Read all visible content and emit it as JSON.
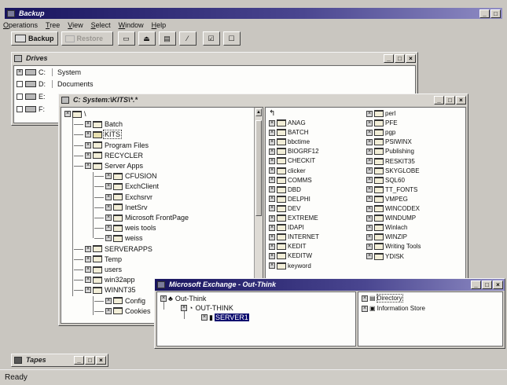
{
  "app": {
    "title": "Backup",
    "menus": [
      "Operations",
      "Tree",
      "View",
      "Select",
      "Window",
      "Help"
    ],
    "toolbar": {
      "backup_label": "Backup",
      "restore_label": "Restore"
    },
    "window_buttons": [
      "_",
      "□",
      "×"
    ]
  },
  "drives": {
    "title": "Drives",
    "items": [
      {
        "letter": "C:",
        "label": "System",
        "checked": true
      },
      {
        "letter": "D:",
        "label": "Documents",
        "checked": false
      },
      {
        "letter": "E:",
        "label": "",
        "checked": false
      },
      {
        "letter": "F:",
        "label": "",
        "checked": false
      }
    ]
  },
  "system_window": {
    "title": "C: System:\\KITS\\*.*",
    "tree": [
      {
        "label": "\\",
        "level": 0
      },
      {
        "label": "Batch",
        "level": 1
      },
      {
        "label": "KITS",
        "level": 1,
        "selected": true
      },
      {
        "label": "Program Files",
        "level": 1
      },
      {
        "label": "RECYCLER",
        "level": 1
      },
      {
        "label": "Server Apps",
        "level": 1
      },
      {
        "label": "CFUSION",
        "level": 2
      },
      {
        "label": "ExchClient",
        "level": 2
      },
      {
        "label": "Exchsrvr",
        "level": 2
      },
      {
        "label": "InetSrv",
        "level": 2
      },
      {
        "label": "Microsoft FrontPage",
        "level": 2
      },
      {
        "label": "weis tools",
        "level": 2
      },
      {
        "label": "weiss",
        "level": 2
      },
      {
        "label": "SERVERAPPS",
        "level": 1
      },
      {
        "label": "Temp",
        "level": 1
      },
      {
        "label": "users",
        "level": 1
      },
      {
        "label": "win32app",
        "level": 1
      },
      {
        "label": "WINNT35",
        "level": 1
      },
      {
        "label": "Config",
        "level": 2
      },
      {
        "label": "Cookies",
        "level": 2
      }
    ],
    "list_col1": [
      "ANAG",
      "BATCH",
      "bbctime",
      "BIOGRF12",
      "CHECKIT",
      "clicker",
      "COMMS",
      "DBD",
      "DELPHI",
      "DEV",
      "EXTREME",
      "IDAPI",
      "INTERNET",
      "KEDIT",
      "KEDITW",
      "keyword"
    ],
    "list_col2": [
      "perl",
      "PFE",
      "pgp",
      "PSIWINX",
      "Publishing",
      "RESKIT35",
      "SKYGLOBE",
      "SQL60",
      "TT_FONTS",
      "VMPEG",
      "WINCODEX",
      "WINDUMP",
      "Winlach",
      "WINZIP",
      "Writing Tools",
      "YDISK"
    ]
  },
  "exchange_window": {
    "title": "Microsoft Exchange - Out-Think",
    "tree": [
      {
        "label": "Out-Think",
        "level": 0
      },
      {
        "label": "OUT-THINK",
        "level": 1
      },
      {
        "label": "SERVER1",
        "level": 2,
        "selected": true
      }
    ],
    "list": [
      "Directory",
      "Information Store"
    ]
  },
  "tapes": {
    "title": "Tapes"
  },
  "status": {
    "text": "Ready"
  }
}
